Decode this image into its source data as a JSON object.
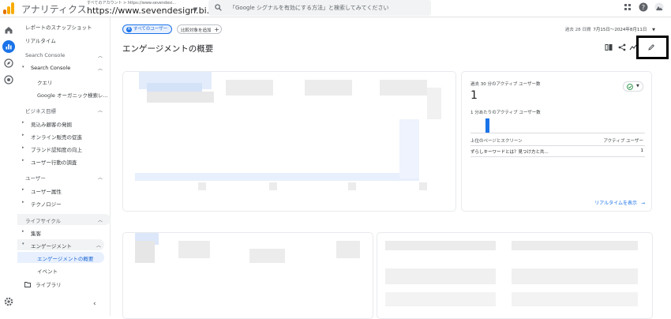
{
  "topbar": {
    "app_name": "アナリティクス",
    "account_line": "すべてのアカウント > https://www.sevendesi...",
    "account_name": "https://www.sevendesign.bi...",
    "search_placeholder": "「Google シグナルを有効にする方法」と検索してみてください"
  },
  "sidebar": {
    "snapshot": "レポートのスナップショット",
    "realtime": "リアルタイム",
    "sections": [
      {
        "label": "Search Console"
      },
      {
        "label": "ビジネス目標"
      },
      {
        "label": "ユーザー"
      },
      {
        "label": "ライフサイクル"
      }
    ],
    "search_console": {
      "title": "Search Console",
      "items": [
        "クエリ",
        "Google オーガニック検索レ..."
      ]
    },
    "business": [
      "見込み顧客の発掘",
      "オンライン販売の促進",
      "ブランド認知度の向上",
      "ユーザー行動の調査"
    ],
    "user": [
      "ユーザー属性",
      "テクノロジー"
    ],
    "lifecycle": {
      "acquisition": "集客",
      "engagement": "エンゲージメント",
      "engagement_items": [
        "エンゲージメントの概要",
        "イベント"
      ]
    },
    "library": "ライブラリ"
  },
  "toolbar": {
    "chip_all_users": "すべてのユーザー",
    "chip_add_compare": "比較対象を追加",
    "date_label": "過去 28 日間",
    "date_range": "7月15日～2024年8月11日"
  },
  "page": {
    "title": "エンゲージメントの概要"
  },
  "realtime_card": {
    "title": "過去 30 分のアクティブ ユーザー数",
    "value": "1",
    "per_minute_label": "1 分あたりのアクティブ ユーザー数",
    "col_page": "上位のページとスクリーン",
    "col_users": "アクティブ ユーザー",
    "row_page": "ずらしキーワードとは？見つけ方と共...",
    "row_users": "1",
    "link": "リアルタイムを表示"
  },
  "colors": {
    "accent": "#1a73e8",
    "logo_orange": "#f9ab00",
    "logo_dark": "#e37400",
    "nav_highlight": "#e8f0fe",
    "status_green": "#1e8e3e"
  }
}
